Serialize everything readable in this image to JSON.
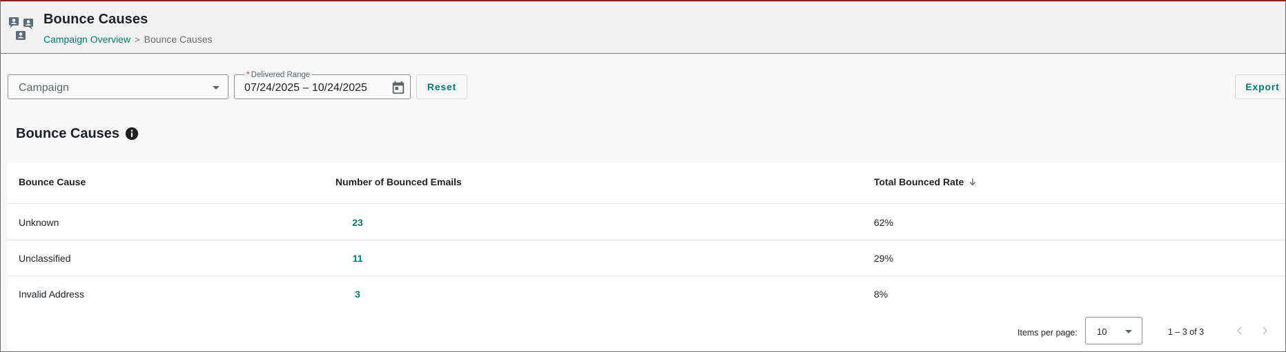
{
  "header": {
    "title": "Bounce Causes",
    "breadcrumb": {
      "parent": "Campaign Overview",
      "separator": ">",
      "current": "Bounce Causes"
    }
  },
  "filters": {
    "campaign": {
      "placeholder": "Campaign"
    },
    "date_range": {
      "label": "Delivered Range",
      "required_marker": "*",
      "value": "07/24/2025 – 10/24/2025"
    },
    "reset_label": "Reset",
    "export_label": "Export"
  },
  "section": {
    "title": "Bounce Causes"
  },
  "table": {
    "columns": {
      "cause": "Bounce Cause",
      "number": "Number of Bounced Emails",
      "rate": "Total Bounced Rate"
    },
    "rows": [
      {
        "cause": "Unknown",
        "number": "23",
        "rate": "62%"
      },
      {
        "cause": "Unclassified",
        "number": "11",
        "rate": "29%"
      },
      {
        "cause": "Invalid Address",
        "number": "3",
        "rate": "8%"
      }
    ]
  },
  "paginator": {
    "items_per_page_label": "Items per page:",
    "items_per_page_value": "10",
    "range_label": "1 – 3 of 3"
  },
  "colors": {
    "accent": "#00796b",
    "required": "#d32f2f"
  }
}
